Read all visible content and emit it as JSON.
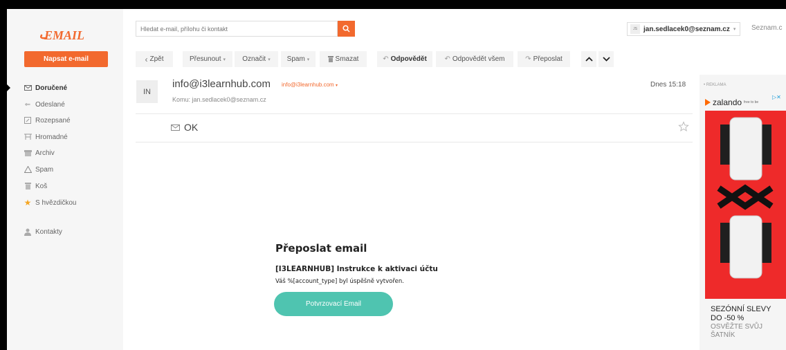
{
  "app": {
    "logo_text": "EMAIL",
    "accent_color": "#f2692e"
  },
  "sidebar": {
    "compose_label": "Napsat e-mail",
    "folders": [
      {
        "label": "Doručené",
        "icon": "inbox-icon",
        "active": true
      },
      {
        "label": "Odeslané",
        "icon": "sent-icon"
      },
      {
        "label": "Rozepsané",
        "icon": "draft-icon"
      },
      {
        "label": "Hromadné",
        "icon": "bulk-icon"
      },
      {
        "label": "Archiv",
        "icon": "archive-icon"
      },
      {
        "label": "Spam",
        "icon": "spam-icon"
      },
      {
        "label": "Koš",
        "icon": "trash-icon"
      },
      {
        "label": "S hvězdičkou",
        "icon": "star-icon"
      },
      {
        "label": "Kontakty",
        "icon": "contacts-icon"
      }
    ]
  },
  "search": {
    "placeholder": "Hledat e-mail, přílohu či kontakt"
  },
  "account": {
    "avatar_initials": "JS",
    "email": "jan.sedlacek0@seznam.cz",
    "seznam_link": "Seznam.c"
  },
  "toolbar": {
    "back": "Zpět",
    "move": "Přesunout",
    "mark": "Označit",
    "spam": "Spam",
    "delete": "Smazat",
    "reply": "Odpovědět",
    "reply_all": "Odpovědět všem",
    "forward": "Přeposlat"
  },
  "message": {
    "avatar_initials": "IN",
    "sender_name": "info@i3learnhub.com",
    "sender_email": "info@i3learnhub.com",
    "recipient": "Komu: jan.sedlacek0@seznam.cz",
    "timestamp": "Dnes 15:18",
    "subject": "OK",
    "body_title": "Přeposlat email",
    "body_subtitle": "[I3LEARNHUB] Instrukce k aktivaci účtu",
    "body_text": "Váš %[account_type] byl úspěšně vytvořen.",
    "button_label": "Potvrzovací Email",
    "button_color": "#4fc4b0"
  },
  "ad": {
    "label": "• REKLAMA",
    "brand": "zalando",
    "tagline": "free to be",
    "headline": "SEZÓNNÍ SLEVY DO -50 %",
    "cta": "OSVĚŽTE SVŮJ ŠATNÍK",
    "image_color": "#ee2a2a"
  }
}
